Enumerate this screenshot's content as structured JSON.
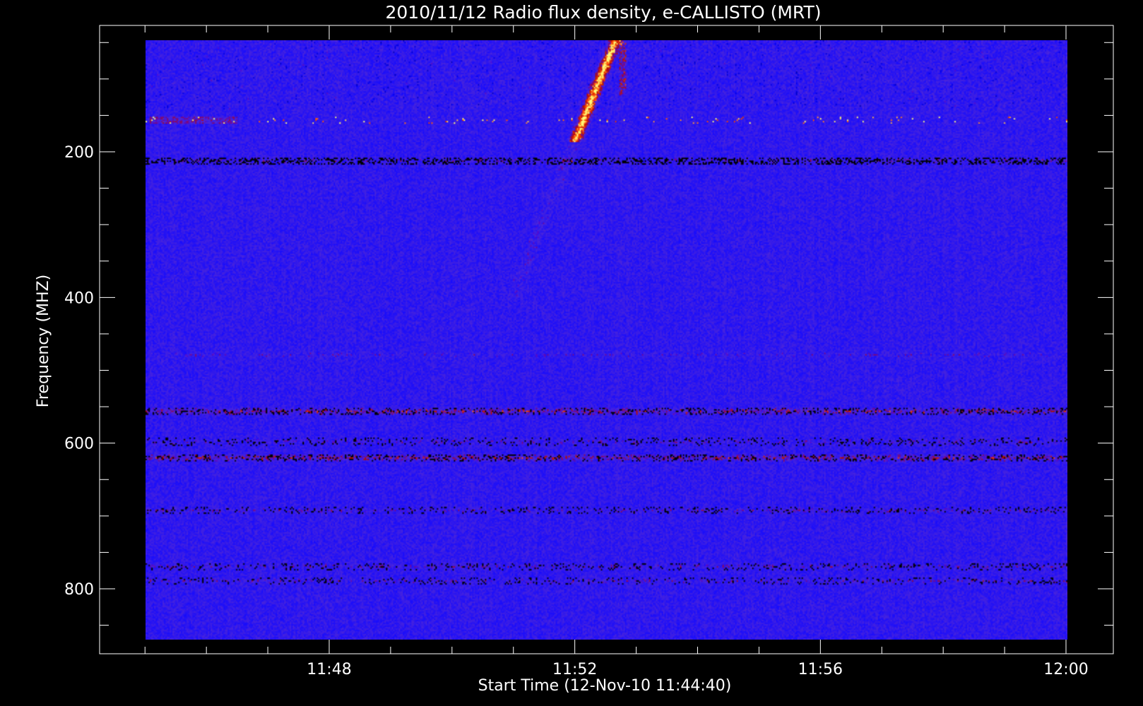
{
  "chart_data": {
    "type": "heatmap",
    "title": "2010/11/12  Radio flux density, e-CALLISTO (MRT)",
    "xlabel": "Start Time (12-Nov-10 11:44:40)",
    "ylabel": "Frequency (MHZ)",
    "x_tick_labels": [
      "11:48",
      "11:52",
      "11:56",
      "12:00"
    ],
    "y_tick_labels": [
      "200",
      "400",
      "600",
      "800"
    ],
    "x_range_minutes": [
      11.0,
      21.0
    ],
    "y_range_mhz": [
      45,
      870
    ],
    "ylim": [
      45,
      890
    ],
    "colormap": [
      "#000000",
      "#1010ff",
      "#3a2ad0",
      "#9a1212",
      "#e83a00",
      "#ffd000",
      "#ffffff"
    ],
    "background_level": "blue",
    "emission_features": [
      {
        "kind": "type III burst",
        "time": "11:53:40",
        "freq_mhz": [
          45,
          180
        ],
        "intensity": "strong"
      },
      {
        "kind": "RFI band",
        "freq_mhz": 155,
        "intensity": "sparse dots"
      },
      {
        "kind": "RFI band",
        "freq_mhz": 210,
        "intensity": "dark/red"
      },
      {
        "kind": "RFI band",
        "freq_mhz": 478,
        "intensity": "weak"
      },
      {
        "kind": "RFI band",
        "freq_mhz": 556,
        "intensity": "strong"
      },
      {
        "kind": "RFI band",
        "freq_mhz": 598,
        "intensity": "moderate"
      },
      {
        "kind": "RFI band",
        "freq_mhz": 620,
        "intensity": "strong"
      },
      {
        "kind": "RFI band",
        "freq_mhz": 693,
        "intensity": "moderate"
      },
      {
        "kind": "RFI band",
        "freq_mhz": 770,
        "intensity": "moderate"
      },
      {
        "kind": "RFI band",
        "freq_mhz": 790,
        "intensity": "moderate"
      }
    ]
  }
}
